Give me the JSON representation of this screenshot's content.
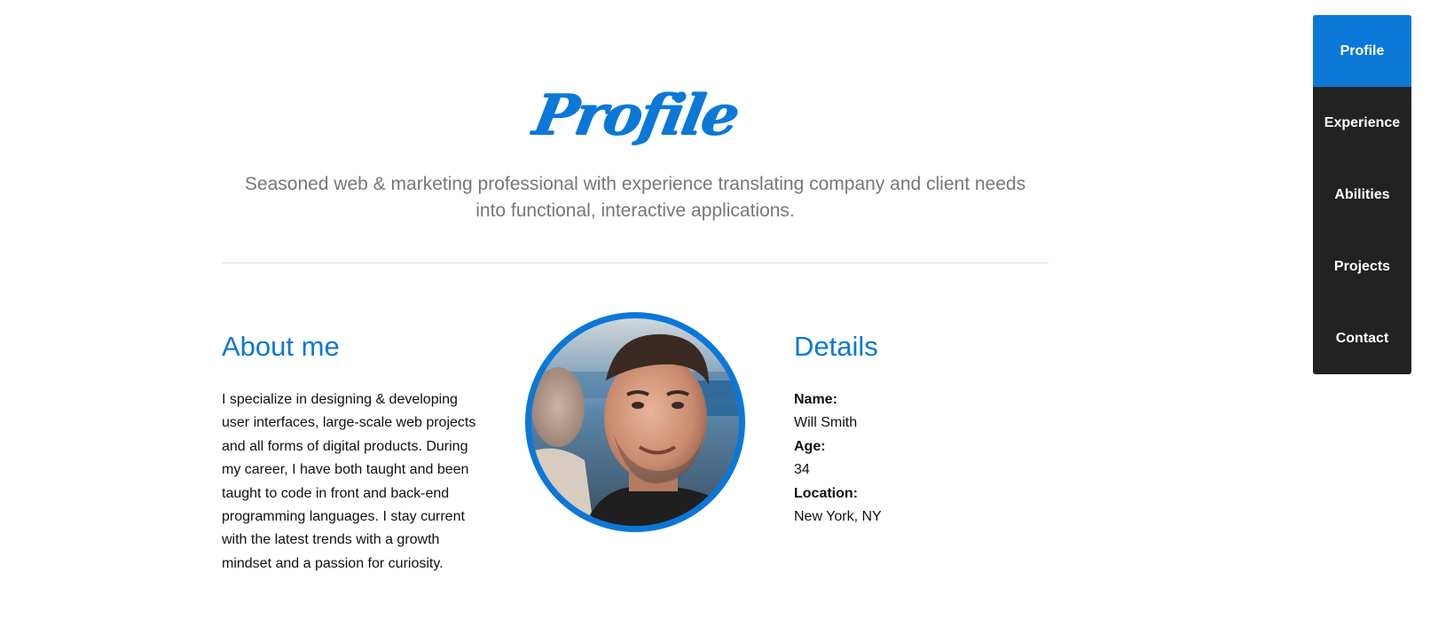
{
  "section": {
    "title": "Profile",
    "lead": "Seasoned web & marketing professional with experience translating company and client needs into functional, interactive applications."
  },
  "about": {
    "title": "About me",
    "text": "I specialize in designing & developing user interfaces, large-scale web projects and all forms of digital products. During my career, I have both taught and been taught to code in front and back-end programming languages. I stay current with the latest trends with a growth mindset and a passion for curiosity."
  },
  "details": {
    "title": "Details",
    "name_label": "Name:",
    "name": "Will Smith",
    "age_label": "Age:",
    "age": "34",
    "location_label": "Location:",
    "location": "New York, NY"
  },
  "nav": {
    "items": [
      {
        "label": "Profile",
        "active": true
      },
      {
        "label": "Experience",
        "active": false
      },
      {
        "label": "Abilities",
        "active": false
      },
      {
        "label": "Projects",
        "active": false
      },
      {
        "label": "Contact",
        "active": false
      }
    ]
  },
  "colors": {
    "accent": "#0b78d8",
    "nav_background": "#222222",
    "lead_text": "#777777"
  }
}
